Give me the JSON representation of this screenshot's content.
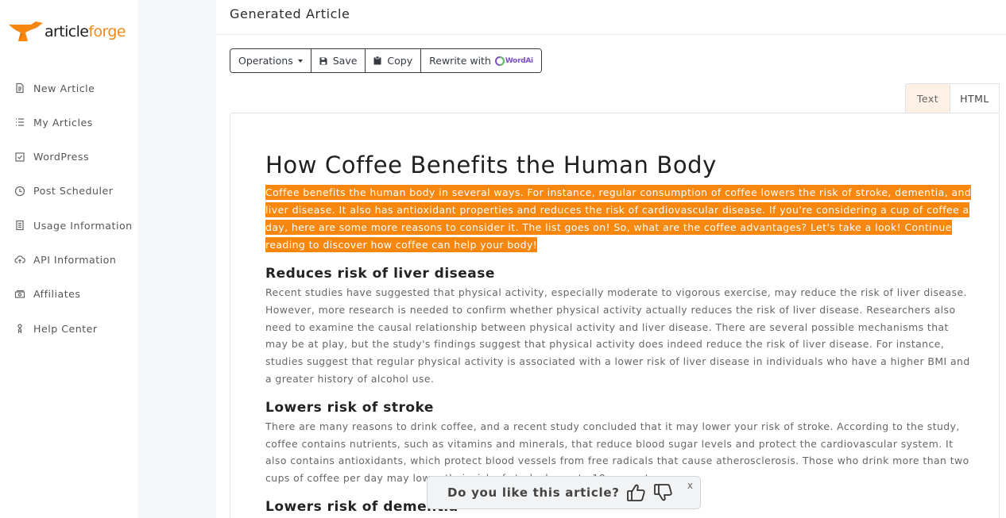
{
  "brand": {
    "name_part1": "article",
    "name_part2": "forge",
    "accent": "#f7870f"
  },
  "sidebar": {
    "items": [
      {
        "label": "New Article",
        "icon": "document-icon"
      },
      {
        "label": "My Articles",
        "icon": "list-icon"
      },
      {
        "label": "WordPress",
        "icon": "check-square-icon"
      },
      {
        "label": "Post Scheduler",
        "icon": "clock-icon"
      },
      {
        "label": "Usage Information",
        "icon": "clipboard-icon"
      },
      {
        "label": "API Information",
        "icon": "cloud-upload-icon"
      },
      {
        "label": "Affiliates",
        "icon": "money-icon"
      },
      {
        "label": "Help Center",
        "icon": "help-icon"
      }
    ]
  },
  "header": {
    "title": "Generated Article"
  },
  "toolbar": {
    "operations_label": "Operations",
    "save_label": "Save",
    "copy_label": "Copy",
    "rewrite_label": "Rewrite with",
    "wordai_label": "WordAi"
  },
  "view_tabs": {
    "text_label": "Text",
    "html_label": "HTML",
    "active": "Text"
  },
  "article": {
    "title": "How Coffee Benefits the Human Body",
    "intro": "Coffee benefits the human body in several ways. For instance, regular consumption of coffee lowers the risk of stroke, dementia, and liver disease. It also has antioxidant properties and reduces the risk of cardiovascular disease. If you're considering a cup of coffee a day, here are some more reasons to consider it. The list goes on! So, what are the coffee advantages? Let's take a look! Continue reading to discover how coffee can help your body!",
    "sections": [
      {
        "heading": "Reduces risk of liver disease",
        "body": "Recent studies have suggested that physical activity, especially moderate to vigorous exercise, may reduce the risk of liver disease. However, more research is needed to confirm whether physical activity actually reduces the risk of liver disease. Researchers also need to examine the causal relationship between physical activity and liver disease. There are several possible mechanisms that may be at play, but the study's findings suggest that physical activity does indeed reduce the risk of liver disease. For instance, studies suggest that regular physical activity is associated with a lower risk of liver disease in individuals who have a higher BMI and a greater history of alcohol use."
      },
      {
        "heading": "Lowers risk of stroke",
        "body": "There are many reasons to drink coffee, and a recent study concluded that it may lower your risk of stroke. According to the study, coffee contains nutrients, such as vitamins and minerals, that reduce blood sugar levels and protect the cardiovascular system. It also contains antioxidants, which protect blood vessels from free radicals that cause atherosclerosis. Those who drink more than two cups of coffee per day may lower their risk of stroke by up to 18 percent."
      },
      {
        "heading": "Lowers risk of dementia",
        "body": ""
      }
    ]
  },
  "feedback": {
    "question": "Do you like this article?",
    "close_label": "x"
  }
}
